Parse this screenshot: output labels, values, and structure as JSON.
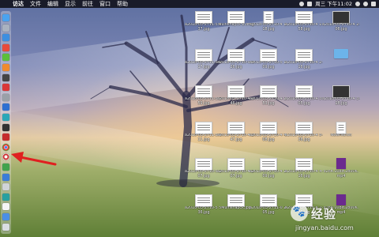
{
  "menubar": {
    "apple": "",
    "items": [
      "访达",
      "文件",
      "编辑",
      "显示",
      "前往",
      "窗口",
      "帮助"
    ],
    "clock": "周三 下午11:02",
    "status_icons": [
      "wifi-icon",
      "battery-icon",
      "search-icon",
      "siri-icon",
      "notification-icon"
    ]
  },
  "dock": {
    "icons": [
      {
        "name": "finder-icon",
        "color": "#4aa3ef"
      },
      {
        "name": "launchpad-icon",
        "color": "#a9b2c0"
      },
      {
        "name": "safari-icon",
        "color": "#3d8fe0"
      },
      {
        "name": "app-red-icon",
        "color": "#e84a3a"
      },
      {
        "name": "app-green-icon",
        "color": "#5cbf3b"
      },
      {
        "name": "app-orange-icon",
        "color": "#f08a2d"
      },
      {
        "name": "app-dark-icon",
        "color": "#444444"
      },
      {
        "name": "app-red2-icon",
        "color": "#d93636"
      },
      {
        "name": "app-gray-icon",
        "color": "#9aa0a8"
      },
      {
        "name": "app-blue-icon",
        "color": "#2e6fd1"
      },
      {
        "name": "app-teal-icon",
        "color": "#2aa7b8"
      },
      {
        "name": "app-dark2-icon",
        "color": "#333333"
      },
      {
        "name": "app-red3-icon",
        "color": "#c62d2d"
      },
      {
        "name": "chrome-icon",
        "color": "#e8e8e8"
      },
      {
        "name": "selected-app-icon",
        "color": "#f2f2f2"
      },
      {
        "name": "app-green2-icon",
        "color": "#3fa34d"
      },
      {
        "name": "app-blue2-icon",
        "color": "#3b7dd8"
      },
      {
        "name": "app-gray2-icon",
        "color": "#cfd3d8"
      },
      {
        "name": "app-teal2-icon",
        "color": "#27a0a0"
      },
      {
        "name": "app-white-icon",
        "color": "#f5f5f5"
      },
      {
        "name": "app-blue3-icon",
        "color": "#4a8fe6"
      },
      {
        "name": "trash-icon",
        "color": "#d9dde2"
      }
    ]
  },
  "files": [
    {
      "label": "a2018-03-2711-5 8-37.jpg",
      "kind": "img"
    },
    {
      "label": "Multisnapck 2.dmg",
      "kind": "img"
    },
    {
      "label": "a2018-03-2710-4 1-18.jpg",
      "kind": "doc"
    },
    {
      "label": "a2018-03-2710-4 1-58.jpg",
      "kind": "img"
    },
    {
      "label": "a2018-03-2710-4 2-06.jpg",
      "kind": "dark"
    },
    {
      "label": "a2018-03-2711-5 6-17.jpg",
      "kind": "img"
    },
    {
      "label": "a2018-03-2710-0 4-26.jpg",
      "kind": "img"
    },
    {
      "label": "a2018-03-2710-5 1-09.jpg",
      "kind": "img"
    },
    {
      "label": "a2018-03-2710-4 2-16.jpg",
      "kind": "img"
    },
    {
      "label": "",
      "kind": "folder"
    },
    {
      "label": "a2018-03-2711-5 9-59.jpg",
      "kind": "img"
    },
    {
      "label": "a2018-03-2710-4 4-46.jpg",
      "kind": "img"
    },
    {
      "label": "a2018-03-2710-4 2-53.jpg",
      "kind": "img"
    },
    {
      "label": "a2018-03-2710-4 3-05.jpg",
      "kind": "img"
    },
    {
      "label": "a2018-03-2710-4 3-18.jpg",
      "kind": "dark"
    },
    {
      "label": "a2018-03-2711-5 4-11.jpg",
      "kind": "img"
    },
    {
      "label": "a2018-03-2710-4 3-47.jpg",
      "kind": "img"
    },
    {
      "label": "a2018-03-2710-4 4-08.jpg",
      "kind": "img"
    },
    {
      "label": "a2018-03-2710-4 5-36.jpg",
      "kind": "img"
    },
    {
      "label": "NewFile.txt",
      "kind": "doc"
    },
    {
      "label": "a2018-03-2710-5 2-07.jpg",
      "kind": "img"
    },
    {
      "label": "a2018-03-2710-4 2-07.jpg",
      "kind": "img"
    },
    {
      "label": "a2018-03-2710-4 2-09.jpg",
      "kind": "img"
    },
    {
      "label": "a2018-03-2710-4 4-16.jpg",
      "kind": "img"
    },
    {
      "label": "x264.10bit.2800K.mp4",
      "kind": "purple"
    },
    {
      "label": "a2018-03-2710-5 5-36.jpg",
      "kind": "img"
    },
    {
      "label": "Multisnapck.jpg",
      "kind": "img"
    },
    {
      "label": "a2018-03-2711-0 2-05.jpg",
      "kind": "img"
    },
    {
      "label": "a2018-03-2711-4 2-36.jpg",
      "kind": "img"
    },
    {
      "label": "x264.10bit.2800K.mp4",
      "kind": "purple"
    }
  ],
  "watermark": {
    "paw": "🐾",
    "text": "经验",
    "url": "jingyan.baidu.com"
  }
}
